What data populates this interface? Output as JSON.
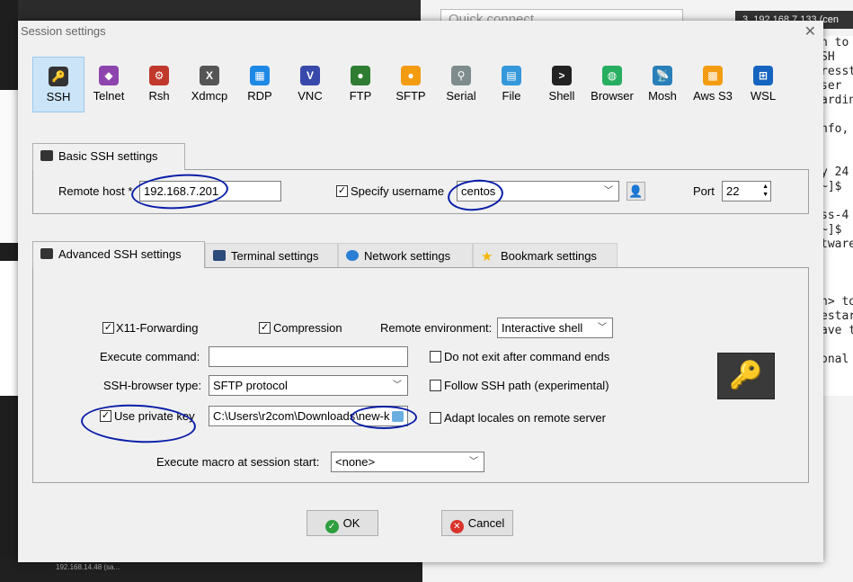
{
  "background": {
    "quick_connect": "Quick connect",
    "session_tab": "3. 192.168.7.133 (cen",
    "terminal_lines": [
      "n to",
      "SH",
      "resst",
      "ser",
      "ardin",
      "",
      "nfo,",
      "",
      "",
      "y 24",
      "~]$",
      "",
      "ss-4",
      "~]$",
      "tware",
      "",
      "",
      "",
      "n> to",
      "estar",
      "ave t",
      "",
      "onal ec"
    ],
    "taskbar_item": "192.168.14.48 (sa..."
  },
  "dialog": {
    "title": "Session settings",
    "close_glyph": "✕"
  },
  "session_types": [
    {
      "label": "SSH",
      "icon": "ssh-key-icon",
      "color": "#333333",
      "glyph": "🔑"
    },
    {
      "label": "Telnet",
      "icon": "telnet-icon",
      "color": "#8e44ad",
      "glyph": "◆"
    },
    {
      "label": "Rsh",
      "icon": "rsh-icon",
      "color": "#c0392b",
      "glyph": "⚙"
    },
    {
      "label": "Xdmcp",
      "icon": "xdmcp-icon",
      "color": "#555555",
      "glyph": "X"
    },
    {
      "label": "RDP",
      "icon": "rdp-icon",
      "color": "#1e88e5",
      "glyph": "▦"
    },
    {
      "label": "VNC",
      "icon": "vnc-icon",
      "color": "#3949ab",
      "glyph": "V"
    },
    {
      "label": "FTP",
      "icon": "ftp-icon",
      "color": "#2e7d32",
      "glyph": "●"
    },
    {
      "label": "SFTP",
      "icon": "sftp-icon",
      "color": "#f39c12",
      "glyph": "●"
    },
    {
      "label": "Serial",
      "icon": "serial-icon",
      "color": "#7f8c8d",
      "glyph": "⚲"
    },
    {
      "label": "File",
      "icon": "file-icon",
      "color": "#3498db",
      "glyph": "▤"
    },
    {
      "label": "Shell",
      "icon": "shell-icon",
      "color": "#222222",
      "glyph": ">"
    },
    {
      "label": "Browser",
      "icon": "browser-icon",
      "color": "#27ae60",
      "glyph": "◍"
    },
    {
      "label": "Mosh",
      "icon": "mosh-icon",
      "color": "#2980b9",
      "glyph": "📡"
    },
    {
      "label": "Aws S3",
      "icon": "aws-s3-icon",
      "color": "#f39c12",
      "glyph": "▩"
    },
    {
      "label": "WSL",
      "icon": "wsl-icon",
      "color": "#1565c0",
      "glyph": "⊞"
    }
  ],
  "basic": {
    "tab_label": "Basic SSH settings",
    "remote_host_label": "Remote host *",
    "remote_host_value": "192.168.7.201",
    "specify_username_label": "Specify username",
    "specify_username_checked": true,
    "username_value": "centos",
    "port_label": "Port",
    "port_value": "22"
  },
  "tabs": {
    "advanced": "Advanced SSH settings",
    "terminal": "Terminal settings",
    "network": "Network settings",
    "bookmark": "Bookmark settings"
  },
  "advanced": {
    "x11_label": "X11-Forwarding",
    "x11_checked": true,
    "compression_label": "Compression",
    "compression_checked": true,
    "remote_env_label": "Remote environment:",
    "remote_env_value": "Interactive shell",
    "exec_cmd_label": "Execute command:",
    "exec_cmd_value": "",
    "no_exit_label": "Do not exit after command ends",
    "no_exit_checked": false,
    "browser_type_label": "SSH-browser type:",
    "browser_type_value": "SFTP protocol",
    "follow_path_label": "Follow SSH path (experimental)",
    "follow_path_checked": false,
    "private_key_label": "Use private key",
    "private_key_checked": true,
    "private_key_value": "C:\\Users\\r2com\\Downloads\\new-k",
    "adapt_locales_label": "Adapt locales on remote server",
    "adapt_locales_checked": false,
    "macro_label": "Execute macro at session start:",
    "macro_value": "<none>"
  },
  "buttons": {
    "ok": "OK",
    "cancel": "Cancel"
  },
  "colors": {
    "selected_bg": "#cce4f7",
    "annotation": "#0a1ea8",
    "ok_icon": "#2e9e3e",
    "cancel_icon": "#d9342b"
  }
}
